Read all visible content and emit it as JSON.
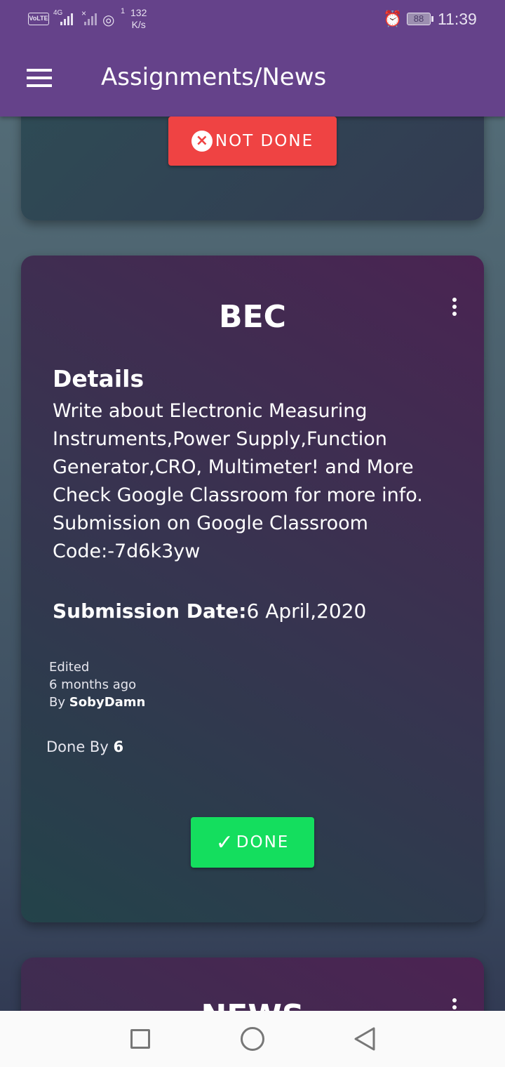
{
  "status_bar": {
    "network_badge": "VoLTE",
    "network_type": "4G",
    "hotspot_count": "1",
    "speed_value": "132",
    "speed_unit": "K/s",
    "battery": "88",
    "time": "11:39"
  },
  "app_bar": {
    "title": "Assignments/News"
  },
  "previous_card": {
    "status_button_label": "NOT DONE"
  },
  "assignment": {
    "subject": "BEC",
    "details_heading": "Details",
    "details_text": "Write about Electronic Measuring Instruments,Power Supply,Function Generator,CRO, Multimeter! and More Check Google Classroom for more info. Submission on Google Classroom Code:-7d6k3yw",
    "submission_label": "Submission Date:",
    "submission_date": "6 April,2020",
    "edited_label": "Edited",
    "edited_time": "6 months ago",
    "by_label": "By",
    "author": "SobyDamn",
    "done_by_label": "Done By",
    "done_by_count": "6",
    "status_button_label": "DONE"
  },
  "next_card": {
    "title": "NEWS"
  },
  "colors": {
    "app_bar": "#65428a",
    "not_done": "#ef4343",
    "done": "#14de5e"
  }
}
